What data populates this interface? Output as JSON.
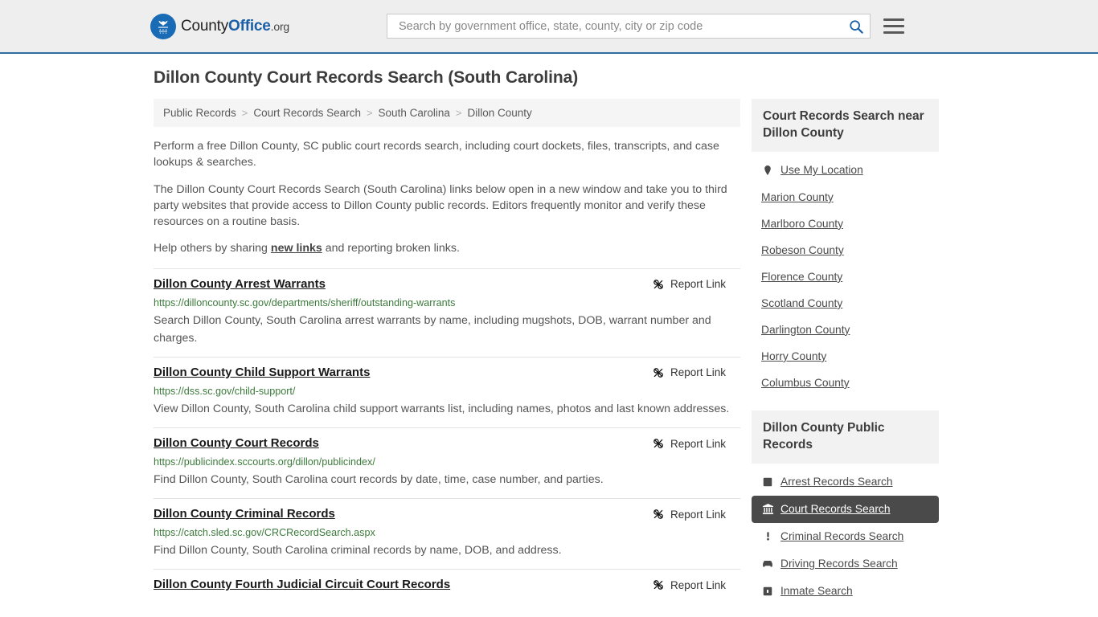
{
  "header": {
    "logo": {
      "part1": "County",
      "part2": "Office",
      "part3": ".org",
      "icon": "eagle-shield-logo"
    },
    "search": {
      "placeholder": "Search by government office, state, county, city or zip code",
      "value": "",
      "icon": "search-icon"
    },
    "menu_icon": "hamburger-menu-icon",
    "accent_color": "#2e6da4",
    "background_color": "#eeeeee"
  },
  "page": {
    "title": "Dillon County Court Records Search (South Carolina)"
  },
  "breadcrumb": {
    "separator": ">",
    "items": [
      {
        "label": "Public Records"
      },
      {
        "label": "Court Records Search"
      },
      {
        "label": "South Carolina"
      },
      {
        "label": "Dillon County"
      }
    ]
  },
  "intro": {
    "paragraph1": "Perform a free Dillon County, SC public court records search, including court dockets, files, transcripts, and case lookups & searches.",
    "paragraph2": "The Dillon County Court Records Search (South Carolina) links below open in a new window and take you to third party websites that provide access to Dillon County public records. Editors frequently monitor and verify these resources on a routine basis.",
    "paragraph3_before": "Help others by sharing ",
    "paragraph3_link": "new links",
    "paragraph3_after": " and reporting broken links."
  },
  "results": {
    "report_label": "Report Link",
    "report_icon": "broken-link-icon",
    "items": [
      {
        "title": "Dillon County Arrest Warrants",
        "url": "https://dilloncounty.sc.gov/departments/sheriff/outstanding-warrants",
        "description": "Search Dillon County, South Carolina arrest warrants by name, including mugshots, DOB, warrant number and charges."
      },
      {
        "title": "Dillon County Child Support Warrants",
        "url": "https://dss.sc.gov/child-support/",
        "description": "View Dillon County, South Carolina child support warrants list, including names, photos and last known addresses."
      },
      {
        "title": "Dillon County Court Records",
        "url": "https://publicindex.sccourts.org/dillon/publicindex/",
        "description": "Find Dillon County, South Carolina court records by date, time, case number, and parties."
      },
      {
        "title": "Dillon County Criminal Records",
        "url": "https://catch.sled.sc.gov/CRCRecordSearch.aspx",
        "description": "Find Dillon County, South Carolina criminal records by name, DOB, and address."
      },
      {
        "title": "Dillon County Fourth Judicial Circuit Court Records",
        "url": "",
        "description": ""
      }
    ]
  },
  "sidebar": {
    "nearby": {
      "heading": "Court Records Search near Dillon County",
      "items": [
        {
          "label": "Use My Location",
          "icon": "map-pin-icon"
        },
        {
          "label": "Marion County",
          "icon": ""
        },
        {
          "label": "Marlboro County",
          "icon": ""
        },
        {
          "label": "Robeson County",
          "icon": ""
        },
        {
          "label": "Florence County",
          "icon": ""
        },
        {
          "label": "Scotland County",
          "icon": ""
        },
        {
          "label": "Darlington County",
          "icon": ""
        },
        {
          "label": "Horry County",
          "icon": ""
        },
        {
          "label": "Columbus County",
          "icon": ""
        }
      ]
    },
    "public_records": {
      "heading": "Dillon County Public Records",
      "active_label": "Court Records Search",
      "items": [
        {
          "label": "Arrest Records Search",
          "icon": "fingerprint-icon",
          "active": false
        },
        {
          "label": "Court Records Search",
          "icon": "courthouse-icon",
          "active": true
        },
        {
          "label": "Criminal Records Search",
          "icon": "exclamation-icon",
          "active": false
        },
        {
          "label": "Driving Records Search",
          "icon": "car-icon",
          "active": false
        },
        {
          "label": "Inmate Search",
          "icon": "jail-icon",
          "active": false
        }
      ]
    }
  }
}
